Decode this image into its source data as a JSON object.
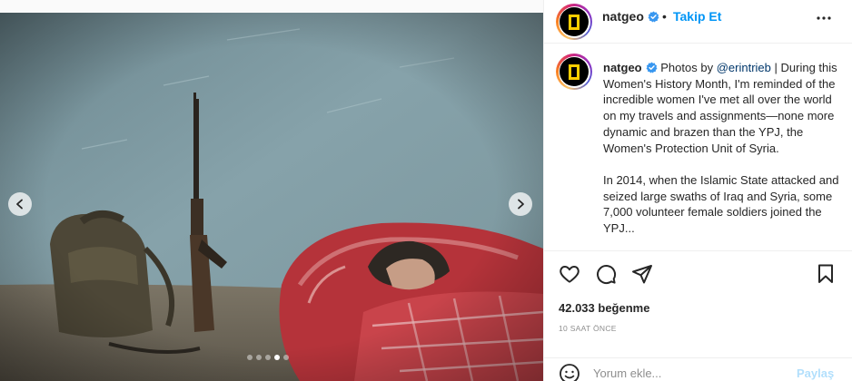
{
  "header": {
    "username": "natgeo",
    "separator": "•",
    "follow_label": "Takip Et",
    "more_icon": "more-horizontal-icon"
  },
  "caption": {
    "username": "natgeo",
    "credit_prefix": "Photos by",
    "credit_handle": "@erintrieb",
    "credit_suffix": "|",
    "paragraph1": "During this Women's History Month, I'm reminded of the incredible women I've met all over the world on my travels and assignments—none more dynamic and brazen than the YPJ, the Women's Protection Unit of Syria.",
    "paragraph2": "In 2014, when the Islamic State attacked and seized large swaths of Iraq and Syria, some 7,000 volunteer female soldiers joined the YPJ..."
  },
  "actions": {
    "icons": [
      "heart-icon",
      "comment-icon",
      "share-icon",
      "bookmark-icon"
    ],
    "likes": "42.033 beğenme",
    "time": "10 SAAT ÖNCE"
  },
  "comment_bar": {
    "placeholder": "Yorum ekle...",
    "share_label": "Paylaş"
  },
  "carousel": {
    "total_slides": 5,
    "active_slide": 4
  },
  "colors": {
    "accent": "#0095f6",
    "share_disabled": "#b2dffc",
    "verified": "#3897f0",
    "natgeo_yellow": "#ffce00"
  }
}
